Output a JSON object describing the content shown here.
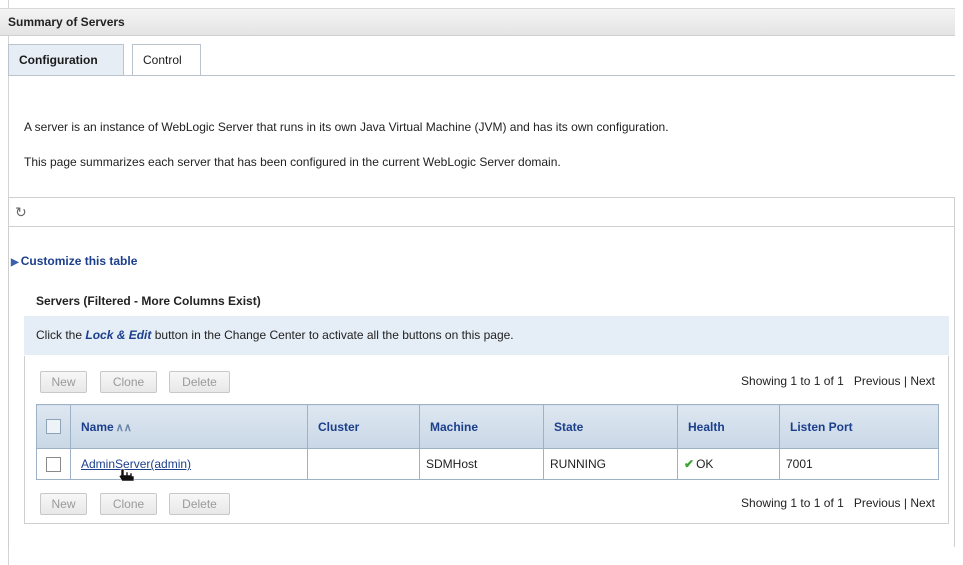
{
  "header": {
    "title": "Summary of Servers"
  },
  "tabs": [
    {
      "label": "Configuration",
      "active": true
    },
    {
      "label": "Control",
      "active": false
    }
  ],
  "description": {
    "line1": "A server is an instance of WebLogic Server that runs in its own Java Virtual Machine (JVM) and has its own configuration.",
    "line2": "This page summarizes each server that has been configured in the current WebLogic Server domain."
  },
  "icons": {
    "refresh": "refresh-icon",
    "customize": "expand-triangle-icon",
    "sort": "sort-ascending-icon",
    "health_ok": "checkmark-icon"
  },
  "customize_label": "Customize this table",
  "table_title": "Servers (Filtered - More Columns Exist)",
  "lock_note": {
    "prefix": "Click the",
    "emphasis": "Lock & Edit",
    "suffix": "button in the Change Center to activate all the buttons on this page."
  },
  "toolbar": {
    "new_label": "New",
    "clone_label": "Clone",
    "delete_label": "Delete"
  },
  "pager": {
    "showing": "Showing 1 to 1 of 1",
    "previous": "Previous",
    "separator": "|",
    "next": "Next"
  },
  "columns": [
    "Name",
    "Cluster",
    "Machine",
    "State",
    "Health",
    "Listen Port"
  ],
  "rows": [
    {
      "name": "AdminServer(admin)",
      "cluster": "",
      "machine": "SDMHost",
      "state": "RUNNING",
      "health": "OK",
      "listen_port": "7001"
    }
  ],
  "colors": {
    "link": "#1c3f8c",
    "header_bg": "#c9d7e6",
    "note_bg": "#e5edf6",
    "health_ok": "#3ba32f"
  }
}
